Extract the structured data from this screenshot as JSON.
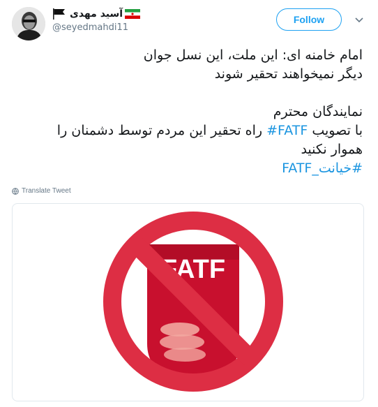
{
  "tweet": {
    "display_name": "آسید مهدی",
    "handle": "@seyedmahdi11",
    "follow_label": "Follow",
    "lines": [
      [
        "امام خامنه ای: این ملت، این نسل جوان",
        null
      ],
      [
        "دیگر نمیخواهند تحقیر شوند",
        null
      ]
    ],
    "line3": "نمایندگان محترم",
    "line4_prefix": "با تصویب ",
    "line4_hashtag": "#FATF",
    "line4_suffix": " راه تحقیر این مردم توسط دشمنان را",
    "line5": "هموار نکنید",
    "hashtag_line": "#خیانت_FATF",
    "translate_label": "Translate Tweet"
  },
  "image": {
    "sign_text": "FATF",
    "colors": {
      "prohibition": "#dd2e44",
      "logo_red": "#c8102e",
      "accent_blue": "#1da1f2"
    }
  }
}
